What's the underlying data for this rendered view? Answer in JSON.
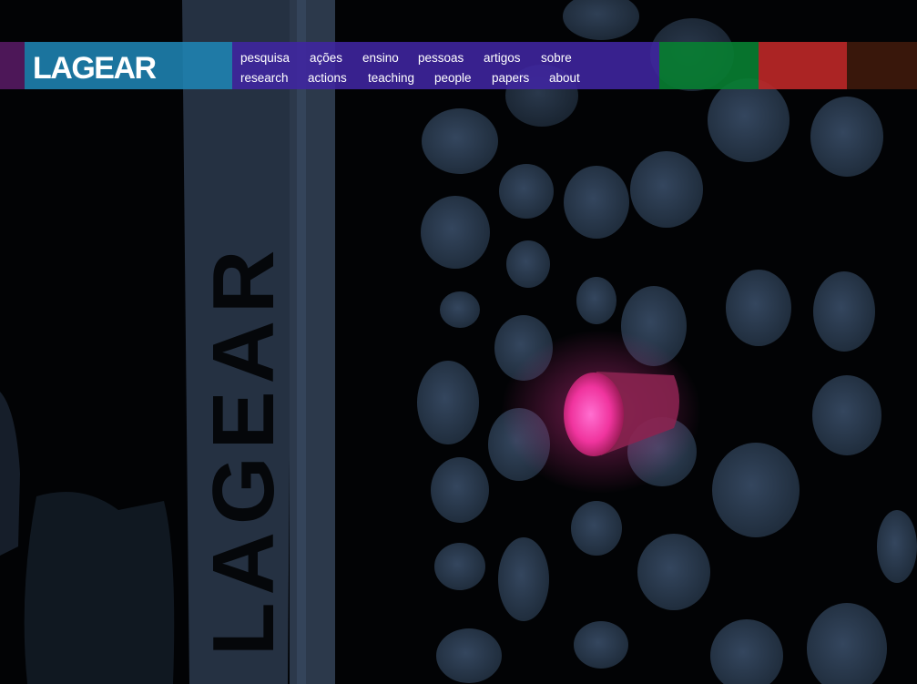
{
  "logo": {
    "text": "LAGEAR"
  },
  "nav": {
    "items": [
      {
        "pt": "pesquisa",
        "en": "research"
      },
      {
        "pt": "ações",
        "en": "actions"
      },
      {
        "pt": "ensino",
        "en": "teaching"
      },
      {
        "pt": "pessoas",
        "en": "people"
      },
      {
        "pt": "artigos",
        "en": "papers"
      },
      {
        "pt": "sobre",
        "en": "about"
      }
    ]
  },
  "banner": {
    "text": "LAGEAR"
  },
  "colors": {
    "purple_left": "#51185d",
    "logo_blue": "#1f84b4",
    "nav_purple": "#4026a2",
    "green": "#088032",
    "red": "#be2828",
    "brown": "#3c180c",
    "glow_pink": "#ff3aa8",
    "disc_blue": "#2a3a4e"
  }
}
